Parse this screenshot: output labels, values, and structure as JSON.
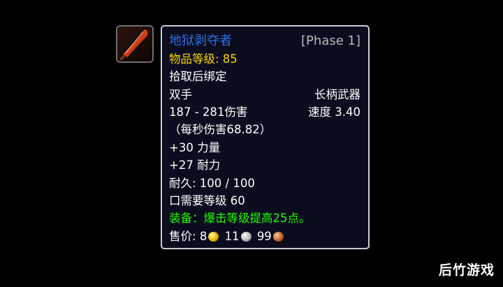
{
  "item": {
    "icon": "polearm-icon",
    "name": "地狱剥夺者",
    "phase": "[Phase 1]",
    "item_level": "物品等级: 85",
    "bind": "拾取后绑定",
    "slot": "双手",
    "type": "长柄武器",
    "damage": "187 - 281伤害",
    "speed": "速度 3.40",
    "dps": "（每秒伤害68.82）",
    "stat1": "+30 力量",
    "stat2": "+27 耐力",
    "durability": "耐久: 100 / 100",
    "requirement": "口需要等级 60",
    "equip_effect": "装备：爆击等级提高25点。",
    "sell_label": "售价: ",
    "sell_gold": "8",
    "sell_silver": "11",
    "sell_copper": "99"
  },
  "colors": {
    "name": "#2f6fe8",
    "item_level": "#ffd100",
    "equip_effect": "#1eff00",
    "phase": "#b8b8b8"
  },
  "watermark": "后竹游戏"
}
